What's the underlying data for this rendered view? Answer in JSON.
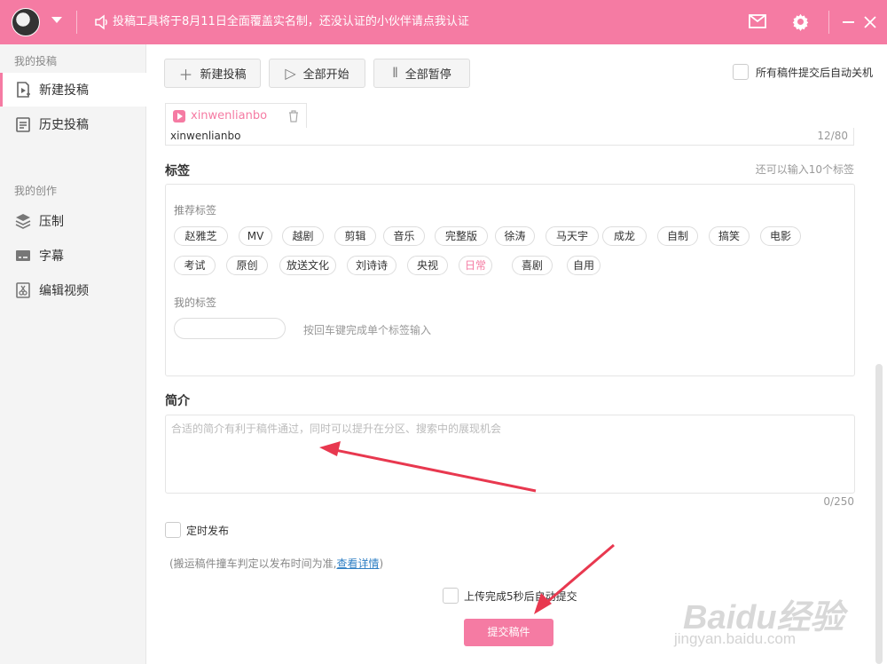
{
  "topbar": {
    "notice": "投稿工具将于8月11日全面覆盖实名制，还没认证的小伙伴请点我认证"
  },
  "sidebar": {
    "section1": "我的投稿",
    "items1": [
      {
        "label": "新建投稿",
        "icon": "new-upload-icon"
      },
      {
        "label": "历史投稿",
        "icon": "history-icon"
      }
    ],
    "section2": "我的创作",
    "items2": [
      {
        "label": "压制",
        "icon": "layers-icon"
      },
      {
        "label": "字幕",
        "icon": "subtitle-icon"
      },
      {
        "label": "编辑视频",
        "icon": "edit-video-icon"
      }
    ]
  },
  "toolbar": {
    "new_label": "新建投稿",
    "start_label": "全部开始",
    "pause_label": "全部暂停",
    "auto_shutdown": "所有稿件提交后自动关机"
  },
  "file": {
    "tab_name": "xinwenlianbo",
    "title_value": "xinwenlianbo",
    "title_count": "12/80"
  },
  "tags": {
    "label": "标签",
    "remaining": "还可以输入10个标签",
    "recommend_label": "推荐标签",
    "recommended": [
      "赵雅芝",
      "MV",
      "越剧",
      "剪辑",
      "音乐",
      "完整版",
      "徐涛",
      "马天宇",
      "成龙",
      "自制",
      "搞笑",
      "电影",
      "考试",
      "原创",
      "放送文化",
      "刘诗诗",
      "央视",
      "日常",
      "喜剧",
      "自用"
    ],
    "selected": "日常",
    "my_label": "我的标签",
    "my_hint": "按回车键完成单个标签输入"
  },
  "description": {
    "label": "简介",
    "placeholder": "合适的简介有利于稿件通过，同时可以提升在分区、搜索中的展现机会",
    "count": "0/250"
  },
  "schedule": {
    "label": "定时发布",
    "note_prefix": "(搬运稿件撞车判定以发布时间为准,",
    "note_link": "查看详情",
    "note_suffix": ")"
  },
  "submit": {
    "auto_label": "上传完成5秒后自动提交",
    "button": "提交稿件"
  },
  "watermark": {
    "logo": "Baidu经验",
    "url": "jingyan.baidu.com"
  },
  "colors": {
    "accent": "#f57ba3",
    "link": "#2f7fc4",
    "annotation_arrow": "#e8384f"
  }
}
